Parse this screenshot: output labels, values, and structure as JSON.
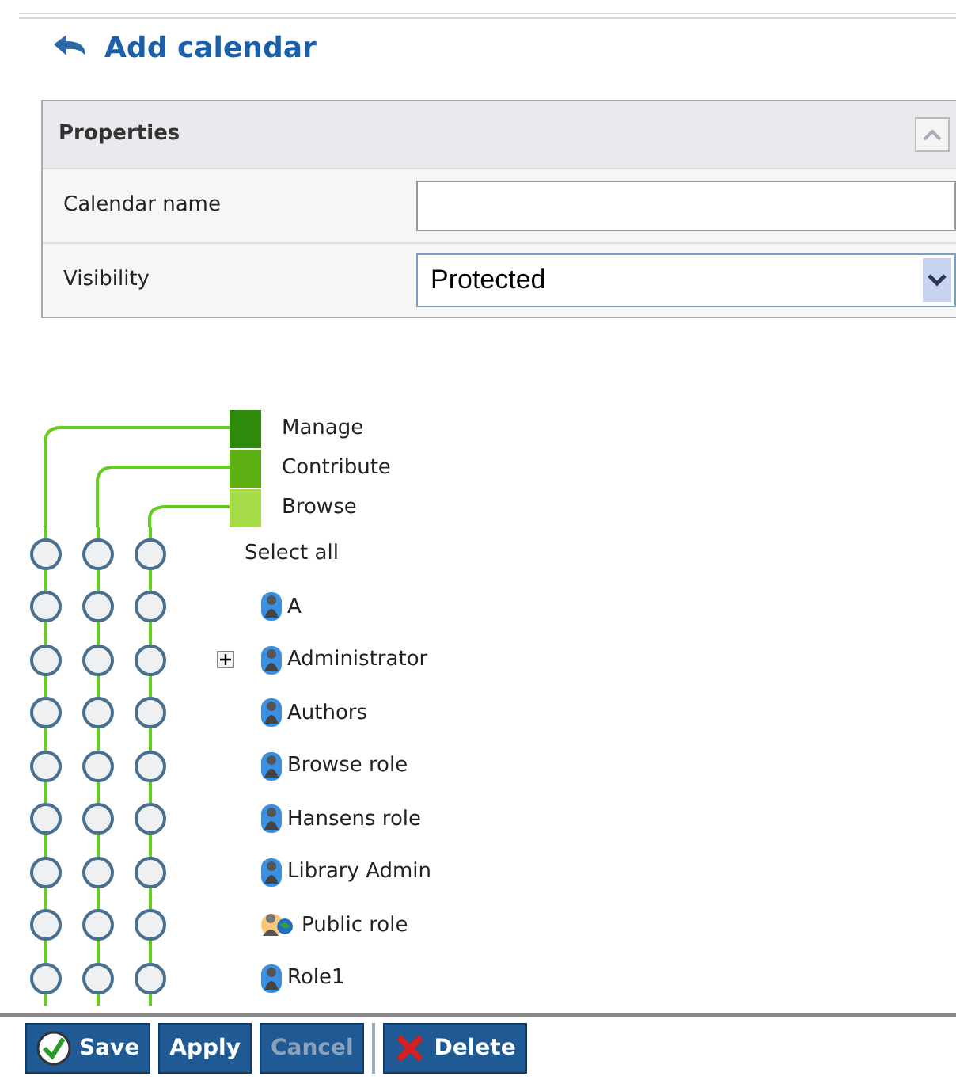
{
  "header": {
    "title": "Add calendar"
  },
  "properties": {
    "title": "Properties",
    "fields": [
      {
        "kind": "text",
        "label": "Calendar name"
      },
      {
        "kind": "select",
        "label": "Visibility",
        "value": "Protected"
      }
    ]
  },
  "permissions": {
    "levels": [
      {
        "label": "Manage",
        "color": "#2e8a0a"
      },
      {
        "label": "Contribute",
        "color": "#5cb012"
      },
      {
        "label": "Browse",
        "color": "#a6dc4a"
      }
    ],
    "rows": [
      {
        "kind": "all",
        "name": "Select all",
        "expandable": false,
        "manage": false,
        "contribute": false,
        "browse": false
      },
      {
        "kind": "role",
        "name": "A",
        "expandable": false,
        "manage": false,
        "contribute": false,
        "browse": false
      },
      {
        "kind": "role",
        "name": "Administrator",
        "expandable": true,
        "manage": false,
        "contribute": false,
        "browse": false
      },
      {
        "kind": "role",
        "name": "Authors",
        "expandable": false,
        "manage": false,
        "contribute": false,
        "browse": false
      },
      {
        "kind": "role",
        "name": "Browse role",
        "expandable": false,
        "manage": false,
        "contribute": false,
        "browse": false
      },
      {
        "kind": "role",
        "name": "Hansens role",
        "expandable": false,
        "manage": false,
        "contribute": false,
        "browse": false
      },
      {
        "kind": "role",
        "name": "Library Admin",
        "expandable": false,
        "manage": false,
        "contribute": false,
        "browse": false
      },
      {
        "kind": "public",
        "name": "Public role",
        "expandable": false,
        "manage": false,
        "contribute": false,
        "browse": false
      },
      {
        "kind": "role",
        "name": "Role1",
        "expandable": false,
        "manage": false,
        "contribute": false,
        "browse": false
      }
    ]
  },
  "buttons": [
    {
      "kind": "save",
      "label": "Save",
      "disabled": false
    },
    {
      "kind": "plain",
      "label": "Apply",
      "disabled": false
    },
    {
      "kind": "plain",
      "label": "Cancel",
      "disabled": true
    },
    {
      "kind": "delete",
      "label": "Delete",
      "disabled": false
    }
  ]
}
